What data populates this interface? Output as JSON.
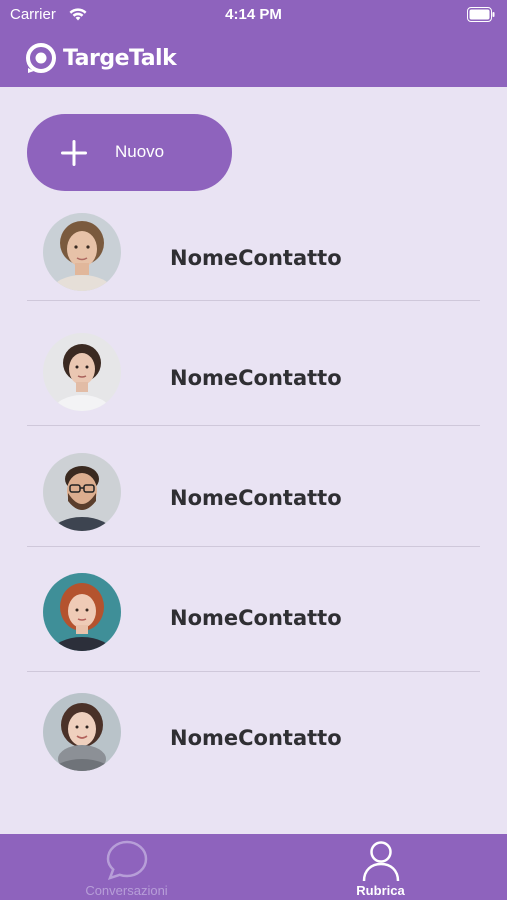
{
  "status_bar": {
    "carrier": "Carrier",
    "time": "4:14 PM"
  },
  "header": {
    "app_name": "TargeTalk"
  },
  "new_button": {
    "label": "Nuovo"
  },
  "contacts": [
    {
      "name": "NomeContatto"
    },
    {
      "name": "NomeContatto"
    },
    {
      "name": "NomeContatto"
    },
    {
      "name": "NomeContatto"
    },
    {
      "name": "NomeContatto"
    }
  ],
  "tabs": [
    {
      "label": "Conversazioni",
      "icon": "chat-bubble-icon",
      "active": false
    },
    {
      "label": "Rubrica",
      "icon": "person-icon",
      "active": true
    }
  ],
  "colors": {
    "brand": "#8e63bd",
    "background": "#e9e3f3",
    "text": "#2f2f33"
  }
}
